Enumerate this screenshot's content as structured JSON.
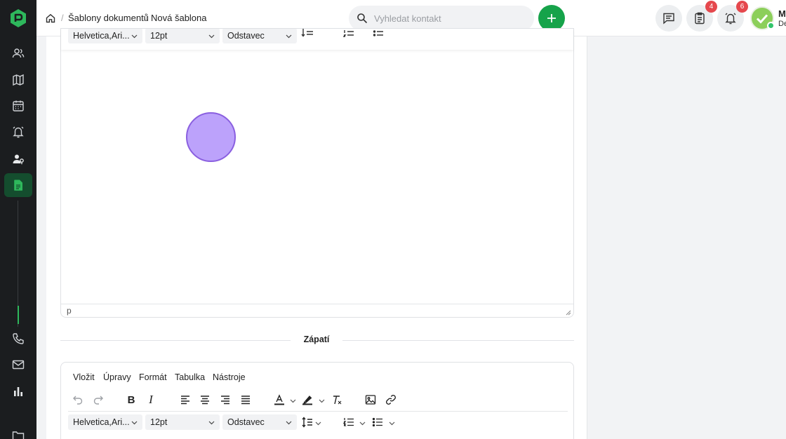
{
  "breadcrumb": {
    "items": [
      "Šablony dokumentů",
      "Nová šablona"
    ],
    "separator": "/"
  },
  "search": {
    "placeholder": "Vyhledat kontakt",
    "value": ""
  },
  "header": {
    "badges": {
      "tasks": "4",
      "notifications": "6"
    },
    "user": {
      "initials": "M",
      "subtitle": "De"
    }
  },
  "editor_top": {
    "font_family": "Helvetica,Ari...",
    "font_size": "12pt",
    "block_format": "Odstavec",
    "status_path": "p"
  },
  "footer_section": {
    "label": "Zápatí"
  },
  "editor_bottom": {
    "menu": [
      "Vložit",
      "Úpravy",
      "Formát",
      "Tabulka",
      "Nástroje"
    ],
    "font_family": "Helvetica,Ari...",
    "font_size": "12pt",
    "block_format": "Odstavec"
  },
  "colors": {
    "accent": "#16a34a",
    "sidebar": "#1b1d1f",
    "badge": "#e5484d",
    "cursor": "#b092fa"
  },
  "icons": {
    "sidebar": [
      "contacts-icon",
      "map-icon",
      "calendar-icon",
      "alarm-icon",
      "user-settings-icon",
      "document-icon",
      "phone-icon",
      "mail-icon",
      "chart-icon",
      "folder-icon"
    ]
  }
}
